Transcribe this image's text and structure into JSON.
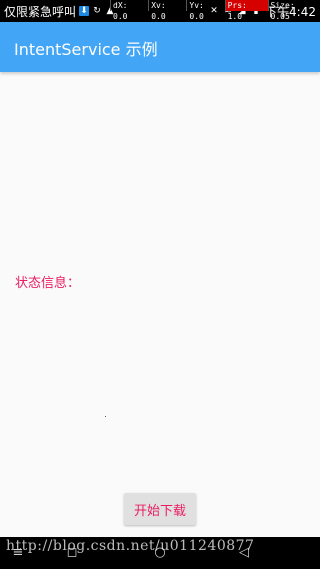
{
  "status_bar": {
    "carrier_text": "仅限紧急呼叫",
    "download_icon": "download-icon",
    "sync_icon": "sync-icon",
    "photo_icon": "image-icon",
    "time": "下午4:42",
    "debug": {
      "dx": "dX: 0.0",
      "xv": "Xv: 0.0",
      "yv": "Yv: 0.0",
      "prs": "Prs: 1.0",
      "size": "Size: 0.05"
    }
  },
  "app_bar": {
    "title": "IntentService 示例",
    "color": "#42a5f5"
  },
  "main": {
    "status_label": "状态信息：",
    "status_label_color": "#e91e63",
    "download_button_label": "开始下载"
  },
  "nav_bar": {
    "back_icon": "back-icon",
    "home_icon": "home-icon",
    "recent_icon": "recent-apps-icon"
  },
  "watermark": "http://blog.csdn.net/u011240877"
}
